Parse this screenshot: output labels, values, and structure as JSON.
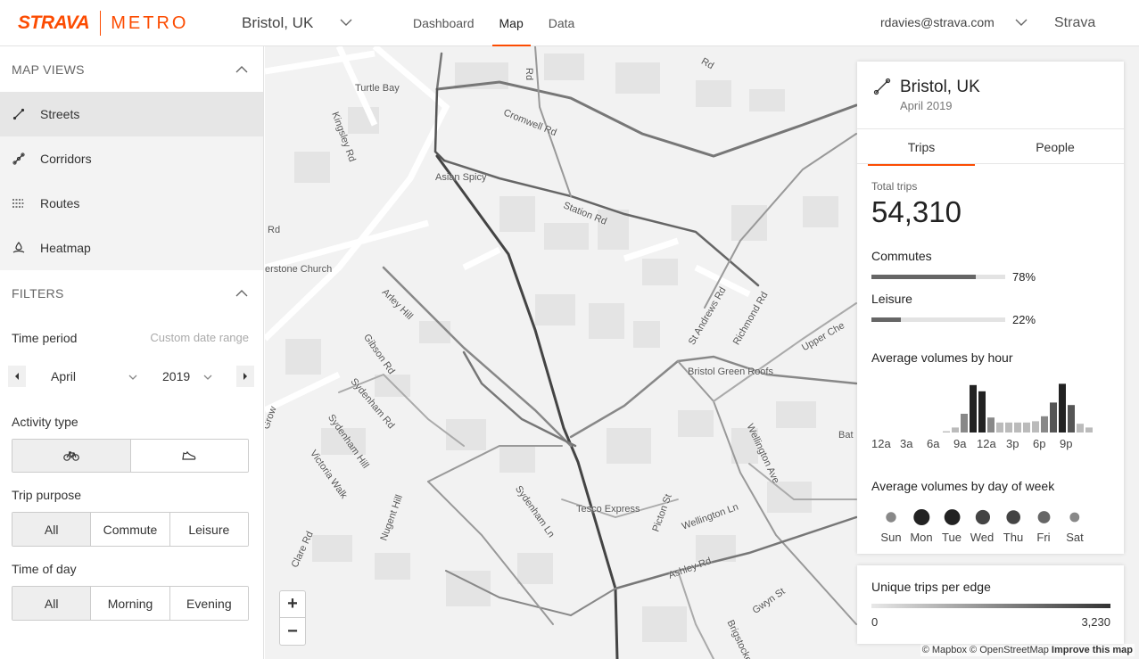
{
  "header": {
    "logo_brand": "STRAVA",
    "logo_product": "METRO",
    "city": "Bristol, UK",
    "nav": [
      "Dashboard",
      "Map",
      "Data"
    ],
    "active_nav": "Map",
    "user_email": "rdavies@strava.com",
    "strava_link": "Strava"
  },
  "sidebar": {
    "map_views_title": "MAP VIEWS",
    "views": [
      {
        "label": "Streets",
        "icon": "streets-icon",
        "active": true
      },
      {
        "label": "Corridors",
        "icon": "corridors-icon",
        "active": false
      },
      {
        "label": "Routes",
        "icon": "routes-icon",
        "active": false
      },
      {
        "label": "Heatmap",
        "icon": "heatmap-icon",
        "active": false
      }
    ],
    "filters_title": "FILTERS",
    "time_period_label": "Time period",
    "custom_range_link": "Custom date range",
    "month": "April",
    "year": "2019",
    "activity_type_label": "Activity type",
    "activity_types": [
      "bike-icon",
      "shoe-icon"
    ],
    "trip_purpose_label": "Trip purpose",
    "trip_purpose_options": [
      "All",
      "Commute",
      "Leisure"
    ],
    "time_of_day_label": "Time of day",
    "time_of_day_options": [
      "All",
      "Morning",
      "Evening"
    ]
  },
  "map": {
    "street_labels": [
      "Kingsley Rd",
      "Turtle Bay",
      "Cromwell Rd",
      "Asian Spicy",
      "Station Rd",
      "erstone Church",
      "Arley Hill",
      "Gibson Rd",
      "Sydenham Rd",
      "Sydenham Hill",
      "Victoria Walk",
      "Nugent Hill",
      "Clare Rd",
      "Sydenham Ln",
      "Tesco Express",
      "Bristol Green Roofs",
      "St Andrews Rd",
      "Richmond Rd",
      "Upper Che",
      "Wellington Ave",
      "Wellington Ln",
      "Picton St",
      "Ashley Rd",
      "Gwyn St",
      "Brigstocke Rd",
      "Bat",
      "Rd",
      "Rd",
      "Grow",
      "Rd"
    ],
    "zoom_in": "+",
    "zoom_out": "−",
    "attribution": "© Mapbox © OpenStreetMap",
    "improve": "Improve this map"
  },
  "panel": {
    "title": "Bristol, UK",
    "date": "April 2019",
    "tabs": [
      "Trips",
      "People"
    ],
    "active_tab": "Trips",
    "total_trips_label": "Total trips",
    "total_trips": "54,310",
    "commutes_label": "Commutes",
    "commutes_pct": "78%",
    "commutes_value": 0.78,
    "leisure_label": "Leisure",
    "leisure_pct": "22%",
    "leisure_value": 0.22,
    "hour_chart_title": "Average volumes by hour",
    "hour_labels": [
      "12a",
      "3a",
      "6a",
      "9a",
      "12a",
      "3p",
      "6p",
      "9p"
    ],
    "dow_chart_title": "Average volumes by day of week",
    "days": [
      "Sun",
      "Mon",
      "Tue",
      "Wed",
      "Thu",
      "Fri",
      "Sat"
    ]
  },
  "chart_data": [
    {
      "type": "bar",
      "title": "Average volumes by hour",
      "categories": [
        "0",
        "1",
        "2",
        "3",
        "4",
        "5",
        "6",
        "7",
        "8",
        "9",
        "10",
        "11",
        "12",
        "13",
        "14",
        "15",
        "16",
        "17",
        "18",
        "19",
        "20",
        "21",
        "22",
        "23"
      ],
      "values": [
        0,
        0,
        0,
        0,
        0,
        1,
        4,
        15,
        38,
        33,
        12,
        8,
        8,
        8,
        8,
        9,
        13,
        24,
        39,
        22,
        7,
        4,
        2,
        1
      ],
      "tick_labels": [
        "12a",
        "3a",
        "6a",
        "9a",
        "12a",
        "3p",
        "6p",
        "9p"
      ]
    },
    {
      "type": "scatter",
      "title": "Average volumes by day of week",
      "categories": [
        "Sun",
        "Mon",
        "Tue",
        "Wed",
        "Thu",
        "Fri",
        "Sat"
      ],
      "values": [
        45,
        100,
        98,
        85,
        80,
        65,
        40
      ]
    }
  ],
  "legend": {
    "title": "Unique trips per edge",
    "min": "0",
    "max": "3,230"
  },
  "colors": {
    "accent": "#fc4c02"
  }
}
